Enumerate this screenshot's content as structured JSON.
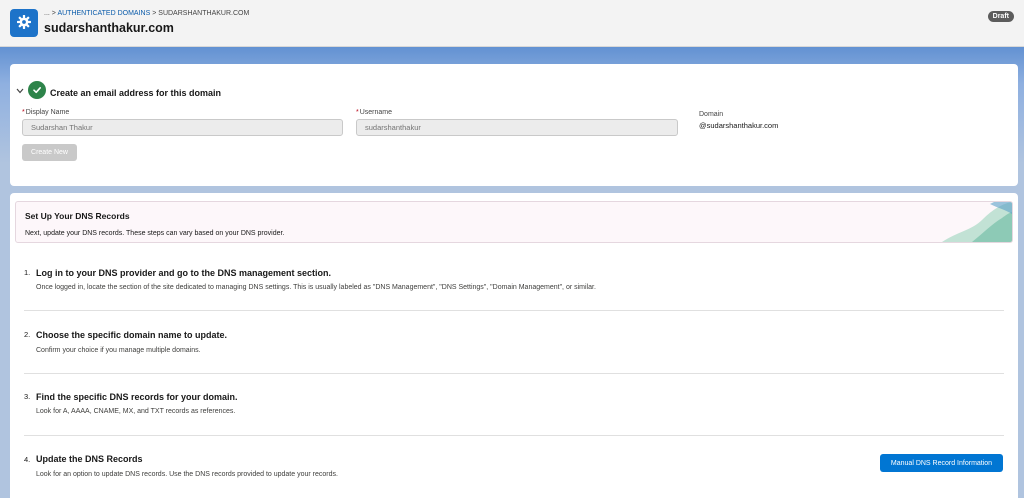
{
  "header": {
    "breadcrumb_ellipsis": "...",
    "breadcrumb_sep": ">",
    "breadcrumb_parent": "AUTHENTICATED DOMAINS",
    "breadcrumb_current": "SUDARSHANTHAKUR.COM",
    "title": "sudarshanthakur.com",
    "status_badge": "Draft",
    "icon": "gear-icon"
  },
  "email_section": {
    "title": "Create an email address for this domain",
    "display_name_label": "Display Name",
    "display_name_value": "Sudarshan Thakur",
    "username_label": "Username",
    "username_value": "sudarshanthakur",
    "domain_label": "Domain",
    "domain_value": "@sudarshanthakur.com",
    "create_button": "Create New",
    "required_marker": "*",
    "status_icon": "check-icon"
  },
  "dns_section": {
    "title": "Set Up Your DNS Records",
    "description": "Next, update your DNS records. These steps can vary based on your DNS provider.",
    "steps": [
      {
        "number": "1.",
        "title": "Log in to your DNS provider and go to the DNS management section.",
        "description": "Once logged in, locate the section of the site dedicated to managing DNS settings. This is usually labeled as \"DNS Management\", \"DNS Settings\", \"Domain Management\", or similar."
      },
      {
        "number": "2.",
        "title": "Choose the specific domain name to update.",
        "description": "Confirm your choice if you manage multiple domains."
      },
      {
        "number": "3.",
        "title": "Find the specific DNS records for your domain.",
        "description": "Look for A, AAAA, CNAME, MX, and TXT records as references."
      },
      {
        "number": "4.",
        "title": "Update the DNS Records",
        "description": "Look for an option to update DNS records. Use the DNS records provided to update your records."
      }
    ],
    "manual_button": "Manual DNS Record Information"
  },
  "colors": {
    "brand_blue": "#0176d3",
    "success_green": "#2e844a",
    "required_red": "#ba0517"
  }
}
